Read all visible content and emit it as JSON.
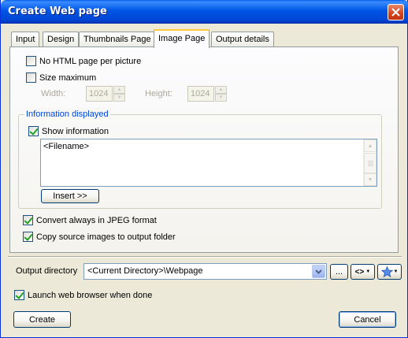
{
  "window": {
    "title": "Create Web page"
  },
  "tabs": [
    {
      "label": "Input"
    },
    {
      "label": "Design"
    },
    {
      "label": "Thumbnails Page"
    },
    {
      "label": "Image Page"
    },
    {
      "label": "Output details"
    }
  ],
  "active_tab": "Image Page",
  "image_page": {
    "no_html_label": "No HTML page per picture",
    "no_html_checked": false,
    "size_max_label": "Size maximum",
    "size_max_checked": false,
    "width_label": "Width:",
    "width_value": "1024",
    "height_label": "Height:",
    "height_value": "1024",
    "info_group_title": "Information displayed",
    "show_info_label": "Show information",
    "show_info_checked": true,
    "info_text": "<Filename>",
    "insert_button": "Insert >>",
    "convert_jpeg_label": "Convert always in JPEG format",
    "convert_jpeg_checked": true,
    "copy_source_label": "Copy source images to output folder",
    "copy_source_checked": true
  },
  "output": {
    "label": "Output directory",
    "value": "<Current Directory>\\Webpage",
    "browse_button": "...",
    "tags_button": "<>",
    "favorites_icon": "star-icon"
  },
  "launch_browser_label": "Launch web browser when done",
  "launch_browser_checked": true,
  "buttons": {
    "create": "Create",
    "cancel": "Cancel"
  },
  "colors": {
    "title_bar": "#0055E5",
    "dialog_bg": "#ECE9D8",
    "group_title": "#0046D5",
    "close_button": "#D5421B"
  }
}
